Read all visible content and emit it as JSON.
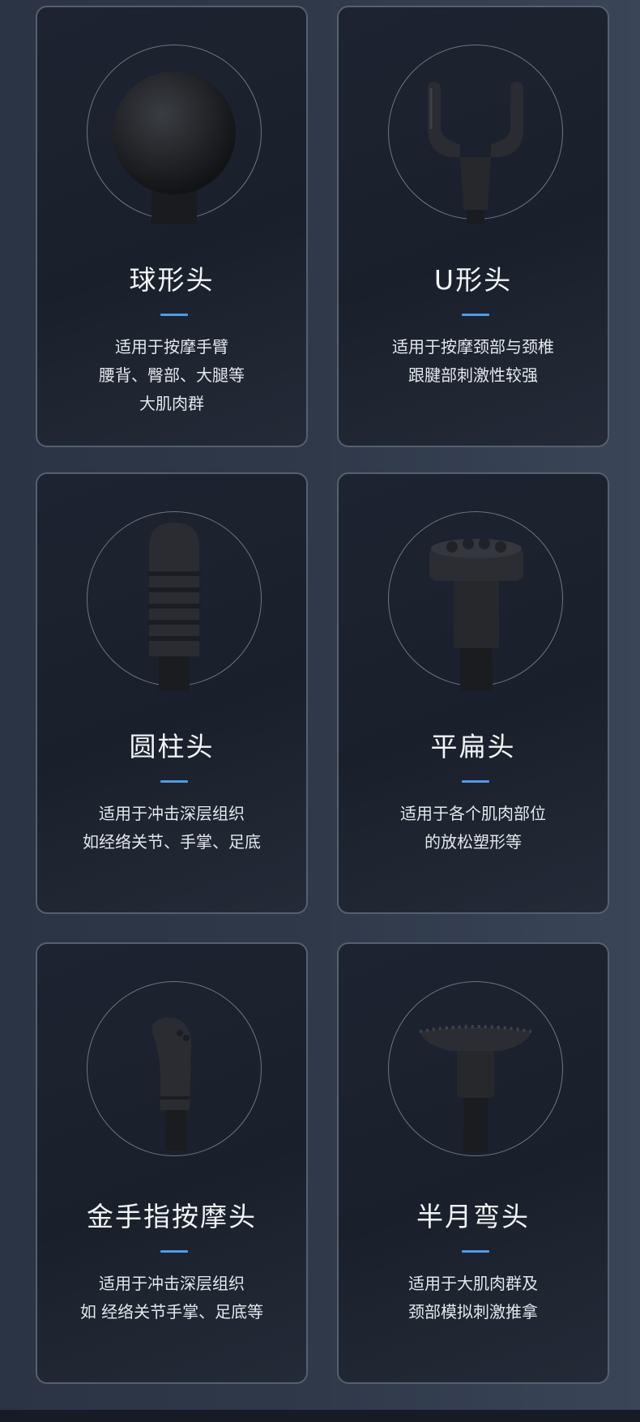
{
  "cards": [
    {
      "title": "球形头",
      "lines": [
        "适用于按摩手臂",
        "腰背、臀部、大腿等",
        "大肌肉群"
      ],
      "head": "ball-head-icon"
    },
    {
      "title": "U形头",
      "lines": [
        "适用于按摩颈部与颈椎",
        "跟腱部刺激性较强"
      ],
      "head": "u-head-icon"
    },
    {
      "title": "圆柱头",
      "lines": [
        "适用于冲击深层组织",
        "如经络关节、手掌、足底"
      ],
      "head": "bullet-head-icon"
    },
    {
      "title": "平扁头",
      "lines": [
        "适用于各个肌肉部位",
        "的放松塑形等"
      ],
      "head": "flat-head-icon"
    },
    {
      "title": "金手指按摩头",
      "lines": [
        "适用于冲击深层组织",
        "如 经络关节手掌、足底等"
      ],
      "head": "finger-head-icon"
    },
    {
      "title": "半月弯头",
      "lines": [
        "适用于大肌肉群及",
        "颈部模拟刺激推拿"
      ],
      "head": "crescent-head-icon"
    }
  ],
  "colors": {
    "accent": "#4f9be6",
    "card_border": "#55606f",
    "text": "#f2f4f7"
  }
}
